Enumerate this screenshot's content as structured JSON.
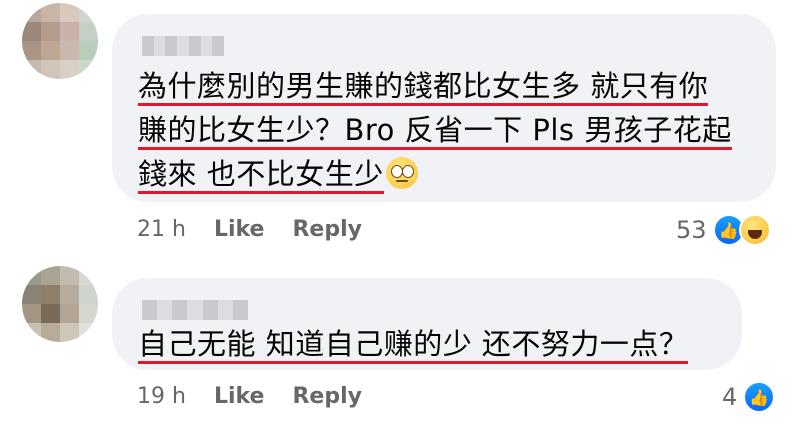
{
  "comments": [
    {
      "lines": [
        "為什麼別的男生賺的錢都比女生多 就只有你",
        "賺的比女生少？Bro 反省一下 Pls 男孩子花起",
        "錢來 也不比女生少"
      ],
      "emoji": "rolling-eyes-emoji",
      "time": "21 h",
      "like_label": "Like",
      "reply_label": "Reply",
      "reaction_count": "53",
      "reactions": [
        "like-icon",
        "haha-icon"
      ]
    },
    {
      "lines": [
        "自己无能 知道自己赚的少 还不努力一点？"
      ],
      "time": "19 h",
      "like_label": "Like",
      "reply_label": "Reply",
      "reaction_count": "4",
      "reactions": [
        "like-icon"
      ]
    }
  ],
  "colors": {
    "bubble_bg": "#f0f2f5",
    "underline": "#e0182b",
    "meta_text": "#65676b",
    "like_blue": "#0866ff"
  }
}
